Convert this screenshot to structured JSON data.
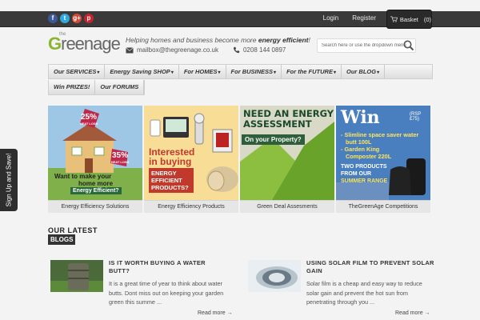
{
  "social": {
    "icons": [
      "facebook-icon",
      "twitter-icon",
      "google-plus-icon",
      "pinterest-icon"
    ],
    "glyphs": [
      "f",
      "t",
      "g+",
      "p"
    ]
  },
  "toplinks": {
    "login": "Login",
    "register": "Register"
  },
  "basket": {
    "label": "Basket",
    "count": "(0)"
  },
  "logo": {
    "the": "the",
    "g": "G",
    "rest": "reenage"
  },
  "header": {
    "tagline_pre": "Helping homes and business become more ",
    "tagline_bold": "energy efficient",
    "tagline_post": "!",
    "email": "mailbox@thegreenage.co.uk",
    "phone": "0208 144 0897"
  },
  "search": {
    "placeholder": "Search here or use the dropdown menu"
  },
  "nav": {
    "items": [
      {
        "label": "Our SERVICES",
        "caret": "▾"
      },
      {
        "label": "Energy Saving SHOP",
        "caret": "▾"
      },
      {
        "label": "For HOMES",
        "caret": "▾"
      },
      {
        "label": "For BUSINESS",
        "caret": "▾"
      },
      {
        "label": "For the FUTURE",
        "caret": "▾"
      },
      {
        "label": "Our BLOG",
        "caret": "▾"
      }
    ],
    "row2": [
      {
        "label": "Win PRIZES!"
      },
      {
        "label": "Our FORUMS"
      }
    ]
  },
  "sidetab": {
    "label": "Sign Up and Save!"
  },
  "tiles": [
    {
      "caption": "Energy Efficiency Solutions",
      "badge1": "25%",
      "badge1_sub": "HEAT LOSS",
      "badge2": "35%",
      "badge2_sub": "HEAT LOSS",
      "text1": "Want to make your",
      "text2": "home more",
      "text3": "Energy Efficient?"
    },
    {
      "caption": "Energy Efficiency Products",
      "line1": "Interested",
      "line2": "in buying",
      "box": "ENERGY EFFICIENT PRODUCTS?"
    },
    {
      "caption": "Green Deal Assesments",
      "line1": "NEED AN ENERGY",
      "line2": "ASSESSMENT",
      "banner": "On your Property?"
    },
    {
      "caption": "TheGreenAge Competitions",
      "win": "Win",
      "rsp": "(RSP £75)",
      "l1": "- Slimline space saver water",
      "l2": "butt 100L",
      "l3": "- Garden King",
      "l4": "Composter 220L",
      "l5": "TWO PRODUCTS",
      "l6": "FROM OUR",
      "l7": "SUMMER RANGE"
    }
  ],
  "blogs": {
    "heading1": "OUR LATEST",
    "heading2": "BLOGS",
    "posts": [
      {
        "title1": "IS IT WORTH BUYING A WATER",
        "title2": "BUTT?",
        "ex1": "It is a great time of year to think about water",
        "ex2": "butts. Dont miss out on keeping your garden",
        "ex3": "green this summe ...",
        "more": "Read more →"
      },
      {
        "title1": "USING SOLAR FILM TO PREVENT SOLAR",
        "title2": "GAIN",
        "ex1": "Solar film is a cheap and easy way to reduce",
        "ex2": "solar gain and prevent the hot sun from",
        "ex3": "penetrating through you ...",
        "more": "Read more →"
      }
    ]
  },
  "colors": {
    "brand_green": "#8bb530",
    "topbar": "#3a3a3a"
  }
}
